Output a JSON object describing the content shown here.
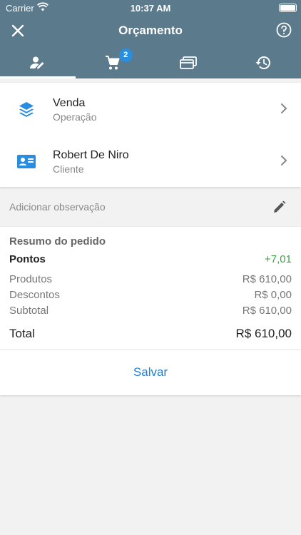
{
  "status": {
    "carrier": "Carrier",
    "time": "10:37 AM"
  },
  "nav": {
    "title": "Orçamento"
  },
  "tabs": [
    {
      "icon": "edit-person-icon",
      "active": true
    },
    {
      "icon": "cart-icon",
      "badge": "2"
    },
    {
      "icon": "cards-icon"
    },
    {
      "icon": "history-icon"
    }
  ],
  "operation": {
    "title": "Venda",
    "subtitle": "Operação"
  },
  "customer": {
    "title": "Robert De Niro",
    "subtitle": "Cliente"
  },
  "observation": {
    "placeholder": "Adicionar observação"
  },
  "summary": {
    "title": "Resumo do pedido",
    "points_label": "Pontos",
    "points_value": "+7,01",
    "products_label": "Produtos",
    "products_value": "R$ 610,00",
    "discounts_label": "Descontos",
    "discounts_value": "R$ 0,00",
    "subtotal_label": "Subtotal",
    "subtotal_value": "R$ 610,00",
    "total_label": "Total",
    "total_value": "R$ 610,00"
  },
  "actions": {
    "save_label": "Salvar"
  },
  "colors": {
    "header": "#5b7a8c",
    "accent": "#2a8ee0",
    "points": "#3aa24a"
  }
}
